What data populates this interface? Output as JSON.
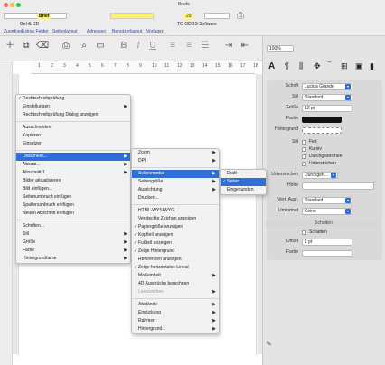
{
  "window": {
    "title": "Briefe",
    "addressee_value": "Brief",
    "field_num": "29",
    "gcc_label": "Gel & CD",
    "status_suffix": "TO ODDS Software"
  },
  "title_row_labels": [
    "Zuordnen",
    "Extras Felder",
    "Seitenlayout",
    "Adressen",
    "Benutzerlayout",
    "Vorlagen"
  ],
  "toolbar": {
    "icons": [
      "plus-icon",
      "duplicate-icon",
      "trash-icon",
      "print-icon",
      "preview-icon",
      "folder-icon",
      "bold-icon",
      "italic-icon",
      "underline-icon",
      "align-icon",
      "list-icon",
      "indent-icon"
    ],
    "zoom": "100%"
  },
  "ruler": {
    "ticks": [
      "1",
      "2",
      "3",
      "4",
      "5",
      "6",
      "7",
      "8",
      "9",
      "10",
      "11",
      "12",
      "13",
      "14",
      "15",
      "16",
      "17",
      "18"
    ]
  },
  "context_menu": {
    "items": [
      {
        "label": "Rechtschreibprüfung",
        "check": true,
        "arrow": false
      },
      {
        "label": "Einstellungen",
        "check": false,
        "arrow": true
      },
      {
        "label": "Rechtschreibprüfung Dialog anzeigen",
        "check": false,
        "arrow": false
      },
      {
        "sep": true
      },
      {
        "label": "Ausschneiden",
        "check": false,
        "arrow": false
      },
      {
        "label": "Kopieren",
        "check": false,
        "arrow": false
      },
      {
        "label": "Einsetzen",
        "check": false,
        "arrow": false
      },
      {
        "sep": true
      },
      {
        "label": "Dokument...",
        "check": false,
        "arrow": true,
        "highlight": true
      },
      {
        "label": "Absatz...",
        "check": false,
        "arrow": true
      },
      {
        "label": "Abschnitt 1",
        "check": false,
        "arrow": true
      },
      {
        "label": "Bilder aktualisieren",
        "check": false,
        "arrow": false
      },
      {
        "label": "Bild einfügen...",
        "check": false,
        "arrow": false
      },
      {
        "label": "Seitenumbruch einfügen",
        "check": false,
        "arrow": false
      },
      {
        "label": "Spaltenumbruch einfügen",
        "check": false,
        "arrow": false
      },
      {
        "label": "Neuen Abschnitt einfügen",
        "check": false,
        "arrow": false
      },
      {
        "sep": true
      },
      {
        "label": "Schriften...",
        "check": false,
        "arrow": false
      },
      {
        "label": "Stil",
        "check": false,
        "arrow": true
      },
      {
        "label": "Größe",
        "check": false,
        "arrow": true
      },
      {
        "label": "Farbe",
        "check": false,
        "arrow": true
      },
      {
        "label": "Hintergrundfarbe",
        "check": false,
        "arrow": true
      }
    ]
  },
  "document_menu": {
    "items": [
      {
        "label": "Zoom",
        "check": false,
        "arrow": true
      },
      {
        "label": "DPI",
        "check": false,
        "arrow": true
      },
      {
        "sep": true
      },
      {
        "label": "Seitenmodus",
        "check": false,
        "arrow": true,
        "highlight": true
      },
      {
        "label": "Seitengröße",
        "check": false,
        "arrow": true
      },
      {
        "label": "Ausrichtung",
        "check": false,
        "arrow": true
      },
      {
        "label": "Drucken...",
        "check": false,
        "arrow": false
      },
      {
        "sep": true
      },
      {
        "label": "HTML-WYSIWYG",
        "check": false,
        "arrow": false
      },
      {
        "label": "Versteckte Zeichen anzeigen",
        "check": false,
        "arrow": false
      },
      {
        "label": "Papiergröße anzeigen",
        "check": true,
        "arrow": false
      },
      {
        "label": "Kopfteil anzeigen",
        "check": true,
        "arrow": false
      },
      {
        "label": "Fußteil anzeigen",
        "check": true,
        "arrow": false
      },
      {
        "label": "Zeige Hintergrund",
        "check": true,
        "arrow": false
      },
      {
        "label": "Referenzen anzeigen",
        "check": false,
        "arrow": false
      },
      {
        "label": "Zeige horizontales Lineal",
        "check": true,
        "arrow": false
      },
      {
        "label": "Maßeinheit",
        "check": false,
        "arrow": true
      },
      {
        "label": "4D Ausdrücke berechnen",
        "check": false,
        "arrow": false
      },
      {
        "label": "Lesezeichen",
        "check": false,
        "arrow": true,
        "disabled": true
      },
      {
        "sep": true
      },
      {
        "label": "Abstände",
        "check": false,
        "arrow": true
      },
      {
        "label": "Einrückung",
        "check": false,
        "arrow": true
      },
      {
        "label": "Rahmen",
        "check": false,
        "arrow": true
      },
      {
        "label": "Hintergrund...",
        "check": false,
        "arrow": true
      }
    ]
  },
  "page_mode_menu": {
    "items": [
      {
        "label": "Draft",
        "check": false
      },
      {
        "label": "Seiten",
        "check": true,
        "highlight": true
      },
      {
        "label": "Eingebunden",
        "check": false
      }
    ]
  },
  "side_panel": {
    "zoom_value": "100%",
    "font_label": "Schrift",
    "font_value": "Lucida Grande",
    "style_label": "Stil",
    "style_value": "Standard",
    "size_label": "Größe",
    "size_value": "12 pt",
    "color_label": "Farbe",
    "bg_label": "Hintergrund",
    "effects_label": "Stil",
    "effect_options": [
      "Fett",
      "Kursiv",
      "Durchgestrichen",
      "Unterstrichen"
    ],
    "underline_label": "Unterstrichen",
    "underline_value": "Durchgeh...",
    "height_label": "Höhe",
    "vert_label": "Vert. Ausr.",
    "vert_value": "Standard",
    "case_label": "Umformat",
    "case_value": "Keine",
    "section_header": "Schatten",
    "shadow_label": "Schatten",
    "offset_label": "Offset",
    "offset_value": "1 pt",
    "blur_label": "Farbe"
  },
  "colors": {
    "accent": "#2f6fd6",
    "menu_bg": "#f2f2f2",
    "window_bg": "#ececec"
  }
}
